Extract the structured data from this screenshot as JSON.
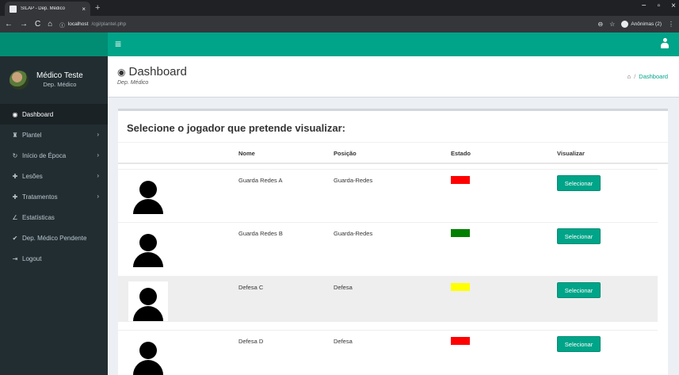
{
  "browser": {
    "tab_title": "SILAP - Dep. Médico",
    "tab_close": "×",
    "new_tab": "+",
    "url_host": "localhost",
    "url_path": "/cgi/plantel.php",
    "incognito_label": "Anônimas (2)",
    "window_min": "−",
    "window_max": "▫",
    "window_close": "×"
  },
  "app": {
    "accent_color": "#00a488",
    "sidebar_color": "#222d32"
  },
  "sidebar": {
    "user_name": "Médico Teste",
    "user_dept": "Dep. Médico",
    "items": [
      {
        "label": "Dashboard",
        "icon": "dashboard-icon",
        "glyph": "◉",
        "active": true,
        "submenu": false
      },
      {
        "label": "Plantel",
        "icon": "team-icon",
        "glyph": "♜",
        "active": false,
        "submenu": true
      },
      {
        "label": "Início de Época",
        "icon": "season-start-icon",
        "glyph": "↻",
        "active": false,
        "submenu": true
      },
      {
        "label": "Lesões",
        "icon": "injury-icon",
        "glyph": "✚",
        "active": false,
        "submenu": true
      },
      {
        "label": "Tratamentos",
        "icon": "treatment-icon",
        "glyph": "✚",
        "active": false,
        "submenu": true
      },
      {
        "label": "Estatísticas",
        "icon": "chart-icon",
        "glyph": "∠",
        "active": false,
        "submenu": false
      },
      {
        "label": "Dep. Médico Pendente",
        "icon": "check-icon",
        "glyph": "✔",
        "active": false,
        "submenu": false
      },
      {
        "label": "Logout",
        "icon": "logout-icon",
        "glyph": "⇥",
        "active": false,
        "submenu": false
      }
    ]
  },
  "header": {
    "title": "Dashboard",
    "subtitle": "Dep. Médico",
    "breadcrumb_sep": "/",
    "breadcrumb_current": "Dashboard"
  },
  "main": {
    "box_title": "Selecione o jogador que pretende visualizar:",
    "columns": [
      "Nome",
      "Posição",
      "Estado",
      "Visualizar"
    ],
    "rows": [
      {
        "name": "Guarda Redes A",
        "position": "Guarda-Redes",
        "status_color": "#ff0000",
        "button": "Selecionar"
      },
      {
        "name": "Guarda Redes B",
        "position": "Guarda-Redes",
        "status_color": "#008000",
        "button": "Selecionar"
      },
      {
        "name": "Defesa C",
        "position": "Defesa",
        "status_color": "#ffff00",
        "button": "Selecionar"
      },
      {
        "name": "Defesa D",
        "position": "Defesa",
        "status_color": "#ff0000",
        "button": "Selecionar"
      }
    ]
  }
}
